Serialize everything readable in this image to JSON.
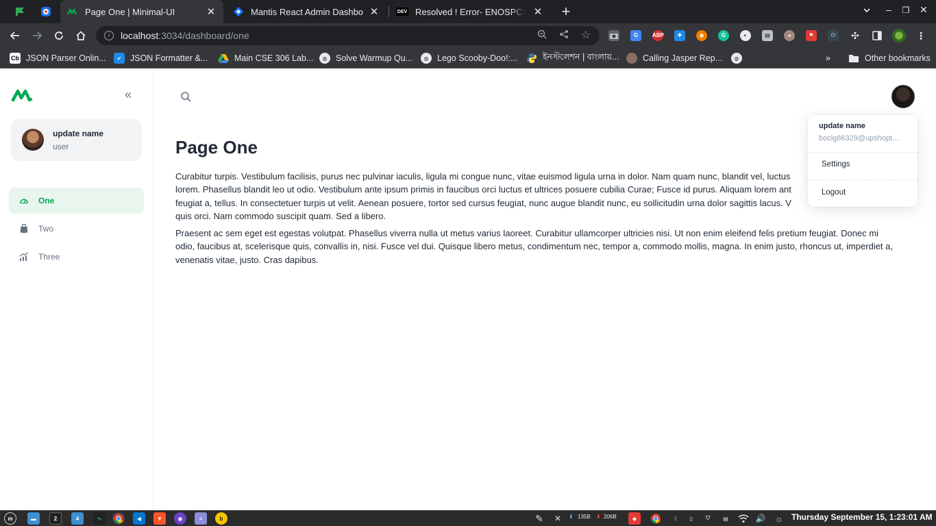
{
  "browser": {
    "tabs": [
      {
        "title": "Page One | Minimal-UI",
        "active": true
      },
      {
        "title": "Mantis React Admin Dashboard",
        "active": false
      },
      {
        "title": "Resolved ! Error- ENOSPC: Syste",
        "active": false
      }
    ],
    "url_host": "localhost",
    "url_path": ":3034/dashboard/one",
    "bookmarks": [
      "JSON Parser Onlin...",
      "JSON Formatter &...",
      "Main CSE 306 Lab...",
      "Solve Warmup Qu...",
      "Lego Scooby-Doo!:...",
      "ইনস্টলেশন | বাংলায়...",
      "Calling Jasper Rep..."
    ],
    "other_bookmarks": "Other bookmarks",
    "extensions": {
      "abp": "ABP",
      "devto": "DEV",
      "cb": "Cb"
    }
  },
  "sidebar": {
    "account": {
      "name": "update name",
      "role": "user"
    },
    "items": [
      {
        "label": "One",
        "active": true
      },
      {
        "label": "Two",
        "active": false
      },
      {
        "label": "Three",
        "active": false
      }
    ]
  },
  "colors": {
    "accent": "#00AB55",
    "active_bg": "#E8F6EE",
    "text": "#212B36",
    "muted": "#637381"
  },
  "main": {
    "title": "Page One",
    "paragraph_1_lines": [
      "Curabitur turpis. Vestibulum facilisis, purus nec pulvinar iaculis, ligula mi congue nunc, vitae euismod ligula urna in dolor. Nam quam nunc, blandit vel, luctus",
      "lorem. Phasellus blandit leo ut odio. Vestibulum ante ipsum primis in faucibus orci luctus et ultrices posuere cubilia Curae; Fusce id purus. Aliquam lorem ant",
      "feugiat a, tellus. In consectetuer turpis ut velit. Aenean posuere, tortor sed cursus feugiat, nunc augue blandit nunc, eu sollicitudin urna dolor sagittis lacus. V",
      "quis orci. Nam commodo suscipit quam. Sed a libero."
    ],
    "paragraph_2_lines": [
      "Praesent ac sem eget est egestas volutpat. Phasellus viverra nulla ut metus varius laoreet. Curabitur ullamcorper ultricies nisi. Ut non enim eleifend felis pretium feugiat. Donec mi",
      "odio, faucibus at, scelerisque quis, convallis in, nisi. Fusce vel dui. Quisque libero metus, condimentum nec, tempor a, commodo mollis, magna. In enim justo, rhoncus ut, imperdiet a,",
      "venenatis vitae, justo. Cras dapibus."
    ]
  },
  "account_menu": {
    "name": "update name",
    "email": "bocig86329@upshopt....",
    "items": [
      "Settings",
      "Logout"
    ]
  },
  "taskbar": {
    "clock": "Thursday September 15, 1:23:01 AM",
    "net_down": "135B",
    "net_up": "206B",
    "badge_1": "2",
    "badge_2": "4"
  }
}
